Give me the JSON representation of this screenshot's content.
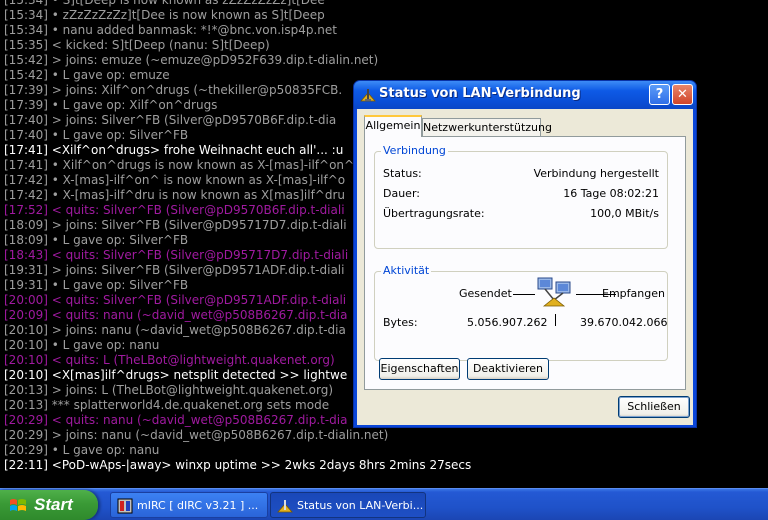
{
  "irc": {
    "lines": [
      {
        "text": "[15:34] • S]t[Deep is now known as zZzZzZzZz]t[Dee",
        "color": "#9e9e9e"
      },
      {
        "text": "[15:34] • zZzZzZzZz]t[Dee is now known as S]t[Deep",
        "color": "#9e9e9e"
      },
      {
        "text": "[15:34] • nanu added banmask: *!*@bnc.von.isp4p.net",
        "color": "#9e9e9e"
      },
      {
        "text": "[15:35] < kicked: S]t[Deep (nanu: S]t[Deep)",
        "color": "#9e9e9e"
      },
      {
        "text": "[15:42] > joins: emuze (~emuze@pD952F639.dip.t-dialin.net)",
        "color": "#9e9e9e"
      },
      {
        "text": "[15:42] • L gave op: emuze",
        "color": "#9e9e9e"
      },
      {
        "text": "[17:39] > joins: Xilf^on^drugs (~thekiller@p50835FCB.",
        "color": "#9e9e9e"
      },
      {
        "text": "[17:39] • L gave op: Xilf^on^drugs",
        "color": "#9e9e9e"
      },
      {
        "text": "[17:40] > joins: Silver^FB (Silver@pD9570B6F.dip.t-dia",
        "color": "#9e9e9e"
      },
      {
        "text": "[17:40] • L gave op: Silver^FB",
        "color": "#9e9e9e"
      },
      {
        "text": "[17:41] <Xilf^on^drugs> frohe Weihnacht euch all'... :u",
        "color": "#ffffff"
      },
      {
        "text": "[17:41] • Xilf^on^drugs is now known as X-[mas]-ilf^on^",
        "color": "#9e9e9e"
      },
      {
        "text": "[17:42] • X-[mas]-ilf^on^ is now known as X-[mas]-ilf^o",
        "color": "#9e9e9e"
      },
      {
        "text": "[17:42] • X-[mas]-ilf^dru is now known as X[mas]ilf^dru",
        "color": "#9e9e9e"
      },
      {
        "text": "[17:52] < quits: Silver^FB (Silver@pD9570B6F.dip.t-diali",
        "color": "#a01aa0"
      },
      {
        "text": "[18:09] > joins: Silver^FB (Silver@pD95717D7.dip.t-diali",
        "color": "#9e9e9e"
      },
      {
        "text": "[18:09] • L gave op: Silver^FB",
        "color": "#9e9e9e"
      },
      {
        "text": "[18:43] < quits: Silver^FB (Silver@pD95717D7.dip.t-diali",
        "color": "#a01aa0"
      },
      {
        "text": "[19:31] > joins: Silver^FB (Silver@pD9571ADF.dip.t-diali",
        "color": "#9e9e9e"
      },
      {
        "text": "[19:31] • L gave op: Silver^FB",
        "color": "#9e9e9e"
      },
      {
        "text": "[20:00] < quits: Silver^FB (Silver@pD9571ADF.dip.t-diali",
        "color": "#a01aa0"
      },
      {
        "text": "[20:09] < quits: nanu (~david_wet@p508B6267.dip.t-dia",
        "color": "#a01aa0"
      },
      {
        "text": "[20:10] > joins: nanu (~david_wet@p508B6267.dip.t-dia",
        "color": "#9e9e9e"
      },
      {
        "text": "[20:10] • L gave op: nanu",
        "color": "#9e9e9e"
      },
      {
        "text": "[20:10] < quits: L (TheLBot@lightweight.quakenet.org)",
        "color": "#a01aa0"
      },
      {
        "text": "[20:10] <X[mas]ilf^drugs> netsplit detected >> lightwe",
        "color": "#ffffff"
      },
      {
        "text": "[20:13] > joins: L (TheLBot@lightweight.quakenet.org)",
        "color": "#9e9e9e"
      },
      {
        "text": "[20:13] *** splatterworld4.de.quakenet.org sets mode",
        "color": "#9e9e9e"
      },
      {
        "text": "[20:29] < quits: nanu (~david_wet@p508B6267.dip.t-dia",
        "color": "#a01aa0"
      },
      {
        "text": "[20:29] > joins: nanu (~david_wet@p508B6267.dip.t-dialin.net)",
        "color": "#9e9e9e"
      },
      {
        "text": "[20:29] • L gave op: nanu",
        "color": "#9e9e9e"
      },
      {
        "text": "[22:11] <PoD-wAps-|away> winxp uptime >> 2wks 2days 8hrs 2mins 27secs",
        "color": "#ffffff"
      }
    ]
  },
  "taskbar": {
    "start_label": "Start",
    "tasks": [
      {
        "label": "mIRC [ dIRC v3.21 ] ...",
        "icon": "mirc-icon"
      },
      {
        "label": "Status von LAN-Verbi...",
        "icon": "network-icon"
      }
    ]
  },
  "dialog": {
    "title": "Status von LAN-Verbindung",
    "help_label": "?",
    "close_label": "✕",
    "tabs": [
      {
        "label": "Allgemein",
        "active": true
      },
      {
        "label": "Netzwerkunterstützung",
        "active": false
      }
    ],
    "connection": {
      "title": "Verbindung",
      "status_label": "Status:",
      "status_value": "Verbindung hergestellt",
      "duration_label": "Dauer:",
      "duration_value": "16 Tage 08:02:21",
      "speed_label": "Übertragungsrate:",
      "speed_value": "100,0 MBit/s"
    },
    "activity": {
      "title": "Aktivität",
      "sent_label": "Gesendet",
      "received_label": "Empfangen",
      "bytes_label": "Bytes:",
      "bytes_sent": "5.056.907.262",
      "bytes_received": "39.670.042.066"
    },
    "properties_label": "Eigenschaften",
    "deactivate_label": "Deaktivieren",
    "close_button_label": "Schließen"
  },
  "colors": {
    "irc_background": "#000000",
    "titlebar": "#0a4ed6",
    "group_title": "#0046d5",
    "taskbar": "#2459d4",
    "start_button": "#3a9a36"
  }
}
